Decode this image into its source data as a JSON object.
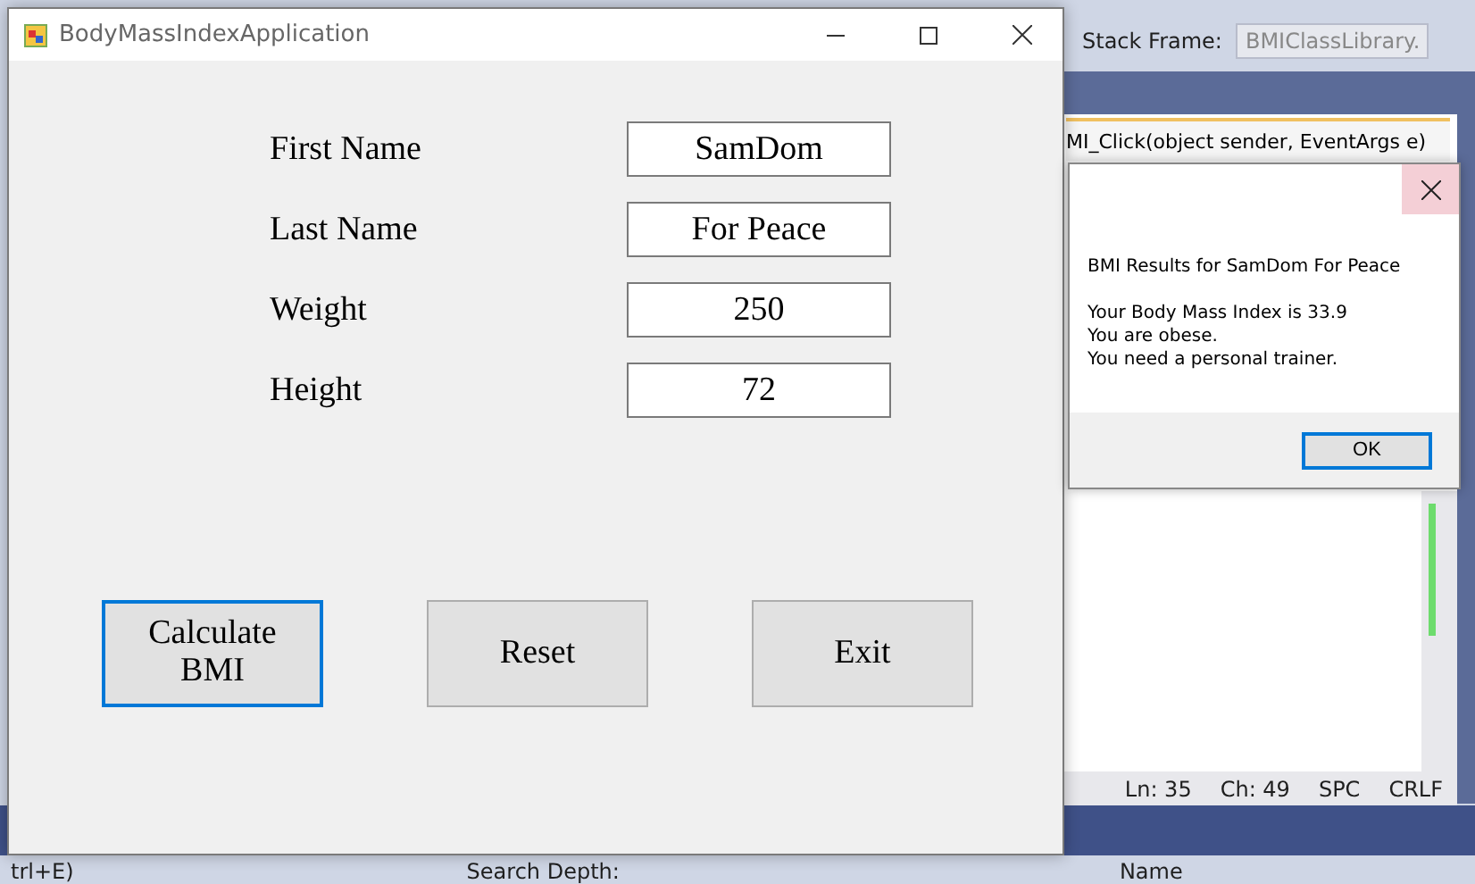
{
  "ide": {
    "stack_frame_label": "Stack Frame:",
    "stack_frame_value": "BMIClassLibrary.",
    "method_dropdown": "MI_Click(object sender, EventArgs e)",
    "status": [
      "Ln: 35",
      "Ch: 49",
      "SPC",
      "CRLF"
    ],
    "search_hint": "trl+E)",
    "search_depth_label": "Search Depth:",
    "column_header": "Name"
  },
  "app_window": {
    "title": "BodyMassIndexApplication",
    "fields": [
      {
        "label": "First Name",
        "value": "SamDom"
      },
      {
        "label": "Last Name",
        "value": "For Peace"
      },
      {
        "label": "Weight",
        "value": "250"
      },
      {
        "label": "Height",
        "value": "72"
      }
    ],
    "buttons": [
      {
        "label": "Calculate BMI",
        "focused": true
      },
      {
        "label": "Reset",
        "focused": false
      },
      {
        "label": "Exit",
        "focused": false
      }
    ]
  },
  "message_box": {
    "heading": "BMI Results for SamDom For Peace",
    "lines": [
      "Your Body Mass Index is 33.9",
      "You are obese.",
      "You need a personal trainer."
    ],
    "ok_button": "OK"
  }
}
